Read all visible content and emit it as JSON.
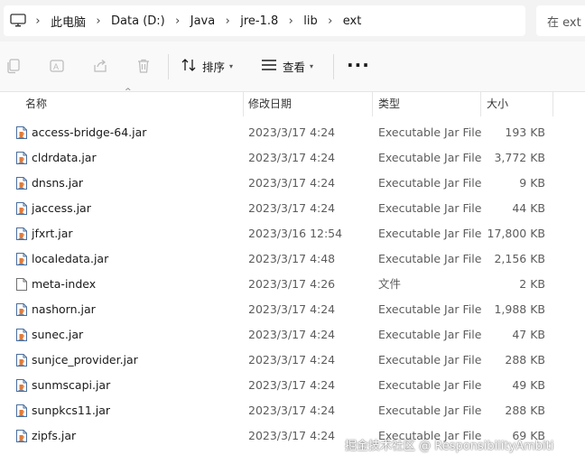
{
  "address_bar": {
    "crumbs": [
      "此电脑",
      "Data (D:)",
      "Java",
      "jre-1.8",
      "lib",
      "ext"
    ],
    "search_placeholder": "在 ext"
  },
  "toolbar": {
    "sort_label": "排序",
    "view_label": "查看",
    "more_label": "···"
  },
  "columns": {
    "name": "名称",
    "date": "修改日期",
    "type": "类型",
    "size": "大小"
  },
  "files": [
    {
      "name": "access-bridge-64.jar",
      "date": "2023/3/17 4:24",
      "type": "Executable Jar File",
      "size": "193 KB",
      "icon": "jar-file-icon"
    },
    {
      "name": "cldrdata.jar",
      "date": "2023/3/17 4:24",
      "type": "Executable Jar File",
      "size": "3,772 KB",
      "icon": "jar-file-icon"
    },
    {
      "name": "dnsns.jar",
      "date": "2023/3/17 4:24",
      "type": "Executable Jar File",
      "size": "9 KB",
      "icon": "jar-file-icon"
    },
    {
      "name": "jaccess.jar",
      "date": "2023/3/17 4:24",
      "type": "Executable Jar File",
      "size": "44 KB",
      "icon": "jar-file-icon"
    },
    {
      "name": "jfxrt.jar",
      "date": "2023/3/16 12:54",
      "type": "Executable Jar File",
      "size": "17,800 KB",
      "icon": "jar-file-icon"
    },
    {
      "name": "localedata.jar",
      "date": "2023/3/17 4:48",
      "type": "Executable Jar File",
      "size": "2,156 KB",
      "icon": "jar-file-icon"
    },
    {
      "name": "meta-index",
      "date": "2023/3/17 4:26",
      "type": "文件",
      "size": "2 KB",
      "icon": "blank-file-icon"
    },
    {
      "name": "nashorn.jar",
      "date": "2023/3/17 4:24",
      "type": "Executable Jar File",
      "size": "1,988 KB",
      "icon": "jar-file-icon"
    },
    {
      "name": "sunec.jar",
      "date": "2023/3/17 4:24",
      "type": "Executable Jar File",
      "size": "47 KB",
      "icon": "jar-file-icon"
    },
    {
      "name": "sunjce_provider.jar",
      "date": "2023/3/17 4:24",
      "type": "Executable Jar File",
      "size": "288 KB",
      "icon": "jar-file-icon"
    },
    {
      "name": "sunmscapi.jar",
      "date": "2023/3/17 4:24",
      "type": "Executable Jar File",
      "size": "49 KB",
      "icon": "jar-file-icon"
    },
    {
      "name": "sunpkcs11.jar",
      "date": "2023/3/17 4:24",
      "type": "Executable Jar File",
      "size": "288 KB",
      "icon": "jar-file-icon"
    },
    {
      "name": "zipfs.jar",
      "date": "2023/3/17 4:24",
      "type": "Executable Jar File",
      "size": "69 KB",
      "icon": "jar-file-icon"
    }
  ],
  "watermark": "掘金技术社区 @ ResponsibilityAmbiti"
}
